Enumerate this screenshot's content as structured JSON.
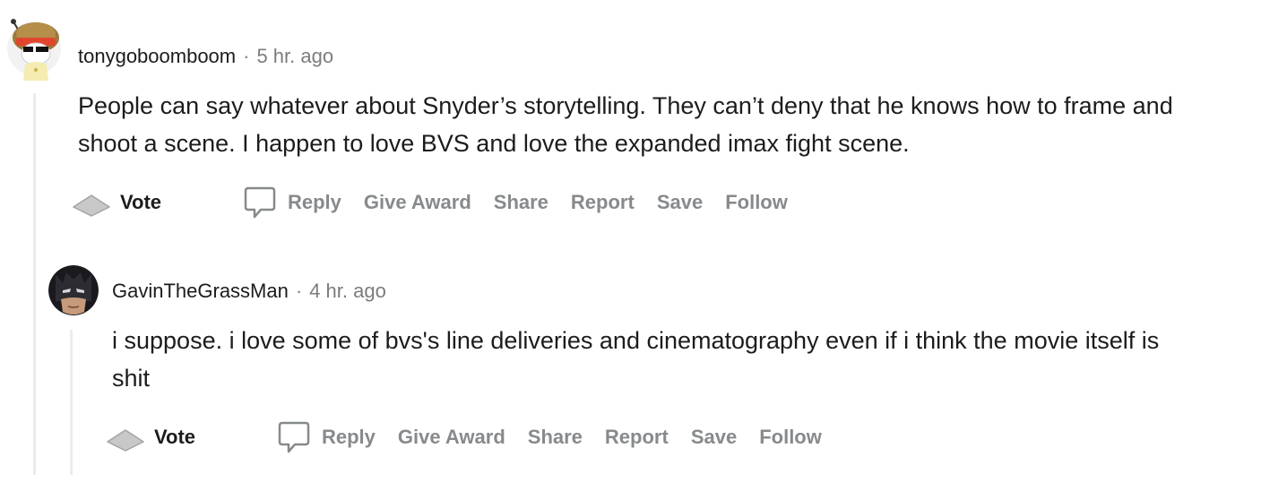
{
  "comments": [
    {
      "username": "tonygoboomboom",
      "separator": "·",
      "time": "5 hr. ago",
      "body": "People can say whatever about Snyder’s storytelling. They can’t deny that he knows how to frame and shoot a scene. I happen to love BVS and love the expanded imax fight scene.",
      "actions": {
        "vote": "Vote",
        "reply": "Reply",
        "give_award": "Give Award",
        "share": "Share",
        "report": "Report",
        "save": "Save",
        "follow": "Follow"
      }
    },
    {
      "username": "GavinTheGrassMan",
      "separator": "·",
      "time": "4 hr. ago",
      "body": "i suppose. i love some of bvs's line deliveries and cinematography even if i think the movie itself is shit",
      "actions": {
        "vote": "Vote",
        "reply": "Reply",
        "give_award": "Give Award",
        "share": "Share",
        "report": "Report",
        "save": "Save",
        "follow": "Follow"
      }
    }
  ],
  "icons": {
    "upvote": "upvote-arrow-icon",
    "reply": "speech-bubble-icon"
  },
  "colors": {
    "action_text": "#878a8c",
    "vote_arrow": "#c8c8c8",
    "thread_line": "#ececec",
    "meta_text": "#7c7c7c"
  }
}
